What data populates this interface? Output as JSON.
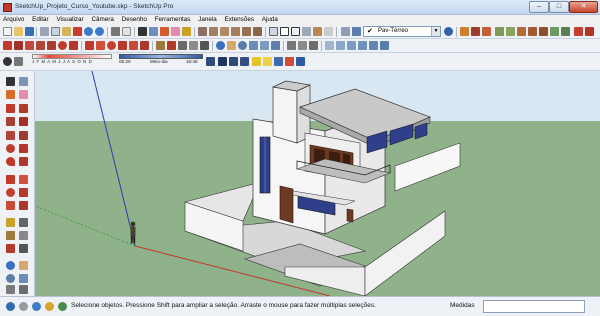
{
  "window": {
    "title": "SketchUp_Projeto_Curso_Youtube.skp - SketchUp Pro",
    "min_label": "–",
    "max_label": "□",
    "close_label": "✕"
  },
  "menu": [
    "Arquivo",
    "Editar",
    "Visualizar",
    "Câmera",
    "Desenho",
    "Ferramentas",
    "Janela",
    "Extensões",
    "Ajuda"
  ],
  "layers": {
    "current_layer": "Pav-Térreo",
    "check_icon": "✔",
    "dropdown_icon": "▼"
  },
  "shadows": {
    "months": "J F M A M J J A S O N D",
    "time_start": "05:29",
    "time_label": "Meio-dia",
    "time_end": "16:48"
  },
  "status": {
    "message": "Selecione objetos. Pressione Shift para ampliar a seleção. Arraste o mouse para fazer múltiplas seleções.",
    "measurements_label": "Medidas",
    "measurements_value": ""
  },
  "colors": {
    "sky": "#d9e7f3",
    "ground": "#8fb28a",
    "axis_red": "#c0392b",
    "axis_green": "#3a9a3a",
    "axis_blue": "#2c3ea8"
  }
}
